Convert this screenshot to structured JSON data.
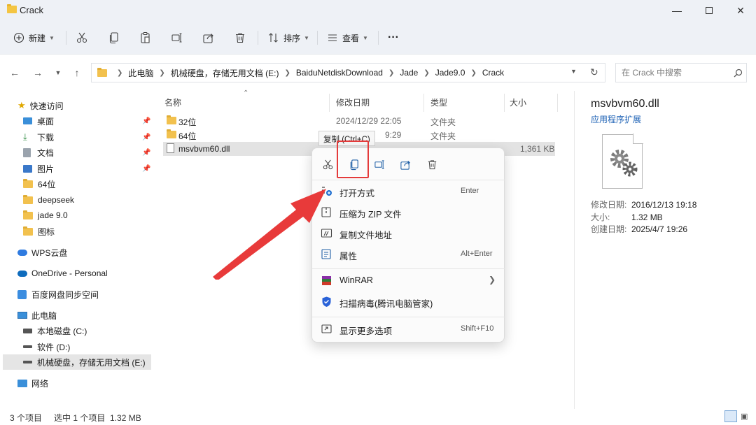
{
  "window": {
    "title": "Crack"
  },
  "toolbar": {
    "new_label": "新建",
    "sort_label": "排序",
    "view_label": "查看",
    "more_label": "···"
  },
  "address": {
    "crumbs": [
      "此电脑",
      "机械硬盘，存储无用文档 (E:)",
      "BaiduNetdiskDownload",
      "Jade",
      "Jade9.0",
      "Crack"
    ],
    "search_placeholder": "在 Crack 中搜索"
  },
  "sidebar": {
    "quick_access": "快速访问",
    "pinned": [
      "桌面",
      "下载",
      "文档",
      "图片"
    ],
    "folders": [
      "64位",
      "deepseek",
      "jade 9.0",
      "图标"
    ],
    "wps": "WPS云盘",
    "onedrive": "OneDrive - Personal",
    "baidu": "百度网盘同步空间",
    "this_pc": "此电脑",
    "drives": [
      "本地磁盘 (C:)",
      "软件 (D:)",
      "机械硬盘，存储无用文档 (E:)"
    ],
    "network": "网络"
  },
  "filelist": {
    "headers": {
      "name": "名称",
      "modified": "修改日期",
      "type": "类型",
      "size": "大小"
    },
    "rows": [
      {
        "name": "32位",
        "modified": "2024/12/29 22:05",
        "type": "文件夹",
        "size": ""
      },
      {
        "name": "64位",
        "modified": "9:29",
        "type": "文件夹",
        "size": ""
      },
      {
        "name": "msvbvm60.dll",
        "modified": "",
        "type": "",
        "size": "1,361 KB"
      }
    ]
  },
  "details": {
    "filename": "msvbvm60.dll",
    "filetype": "应用程序扩展",
    "props": [
      {
        "k": "修改日期:",
        "v": "2016/12/13 19:18"
      },
      {
        "k": "大小:",
        "v": "1.32 MB"
      },
      {
        "k": "创建日期:",
        "v": "2025/4/7 19:26"
      }
    ]
  },
  "tooltip": "复制 (Ctrl+C)",
  "context_menu": {
    "items": [
      {
        "label": "打开方式",
        "shortcut": "Enter"
      },
      {
        "label": "压缩为 ZIP 文件",
        "shortcut": ""
      },
      {
        "label": "复制文件地址",
        "shortcut": ""
      },
      {
        "label": "属性",
        "shortcut": "Alt+Enter"
      },
      {
        "label": "WinRAR",
        "shortcut": ""
      },
      {
        "label": "扫描病毒(腾讯电脑管家)",
        "shortcut": ""
      },
      {
        "label": "显示更多选项",
        "shortcut": "Shift+F10"
      }
    ]
  },
  "status": {
    "count": "3 个项目",
    "selected": "选中 1 个项目  1.32 MB"
  },
  "colors": {
    "highlight": "#e43b3b",
    "accent": "#1a5fb4",
    "folder": "#f2c14e"
  }
}
